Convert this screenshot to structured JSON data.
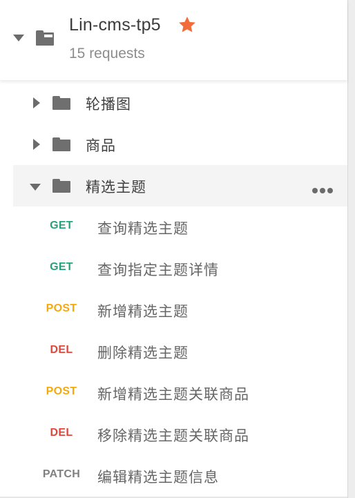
{
  "collection": {
    "title": "Lin-cms-tp5",
    "request_count": "15 requests",
    "favorite_color": "#f26b3a"
  },
  "folders": [
    {
      "label": "轮播图",
      "expanded": false
    },
    {
      "label": "商品",
      "expanded": false
    },
    {
      "label": "精选主题",
      "expanded": true
    }
  ],
  "requests": [
    {
      "method": "GET",
      "method_color": "#26a17b",
      "name": "查询精选主题"
    },
    {
      "method": "GET",
      "method_color": "#26a17b",
      "name": "查询指定主题详情"
    },
    {
      "method": "POST",
      "method_color": "#f5a90a",
      "name": "新增精选主题"
    },
    {
      "method": "DEL",
      "method_color": "#e0463a",
      "name": "删除精选主题"
    },
    {
      "method": "POST",
      "method_color": "#f5a90a",
      "name": "新增精选主题关联商品"
    },
    {
      "method": "DEL",
      "method_color": "#e0463a",
      "name": "移除精选主题关联商品"
    },
    {
      "method": "PATCH",
      "method_color": "#808080",
      "name": "编辑精选主题信息"
    }
  ]
}
